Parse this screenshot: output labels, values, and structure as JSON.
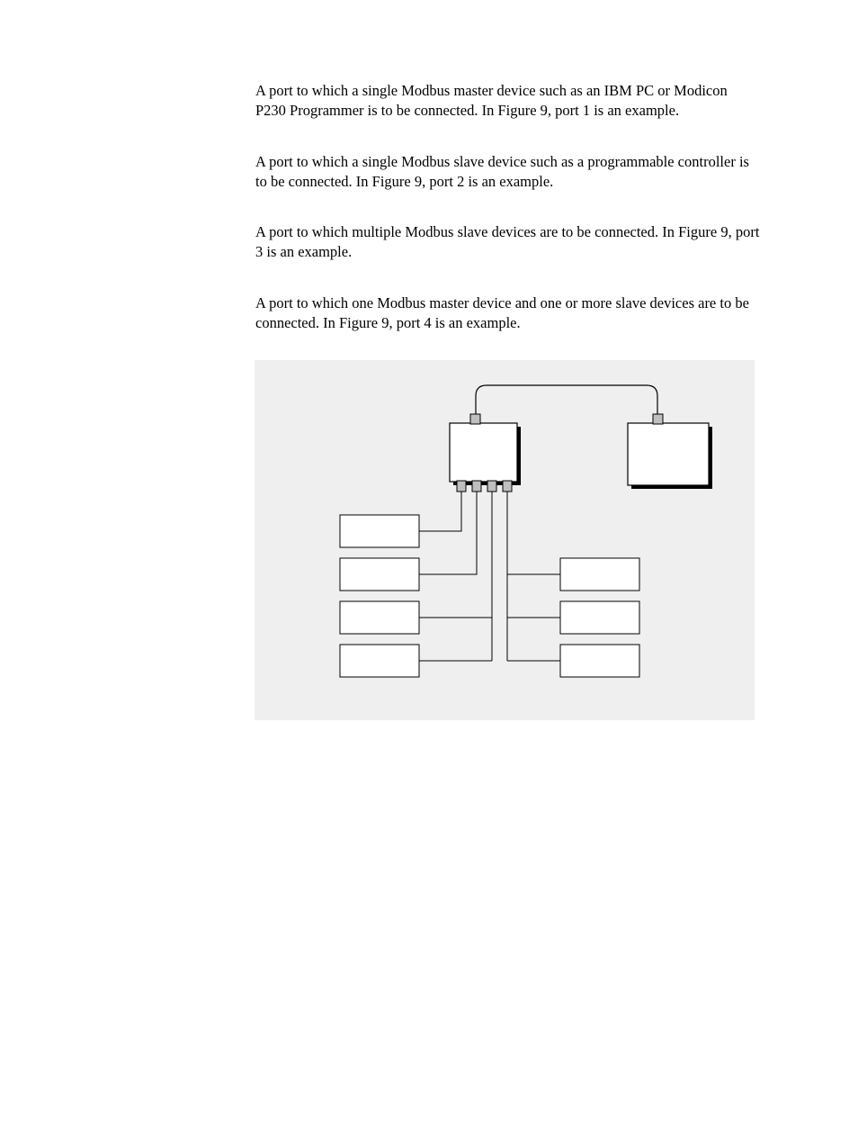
{
  "paragraphs": {
    "p1": "A port to which a single Modbus master device such as an IBM PC or Modicon P230 Programmer is to be connected.  In Figure 9, port 1 is an example.",
    "p2": "A port to which a single Modbus slave device such as a programmable controller is to be connected.  In Figure 9, port 2 is an example.",
    "p3": "A port to which multiple Modbus slave devices are to be connected.  In Figure 9, port 3 is an example.",
    "p4": "A port to which one Modbus master device and one or more slave devices are to be connected.  In Figure 9, port 4 is an example."
  }
}
